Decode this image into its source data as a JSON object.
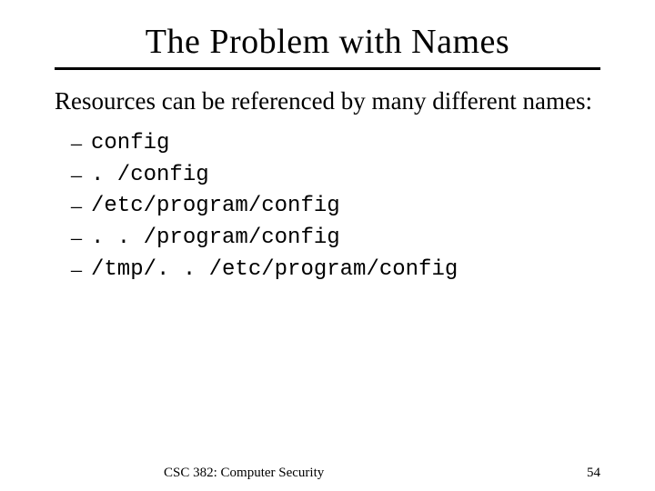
{
  "title": "The Problem with Names",
  "intro": "Resources can be referenced by many different names:",
  "items": [
    "config",
    ". /config",
    "/etc/program/config",
    ". . /program/config",
    "/tmp/. . /etc/program/config"
  ],
  "footer": {
    "course": "CSC 382: Computer Security",
    "page": "54"
  }
}
